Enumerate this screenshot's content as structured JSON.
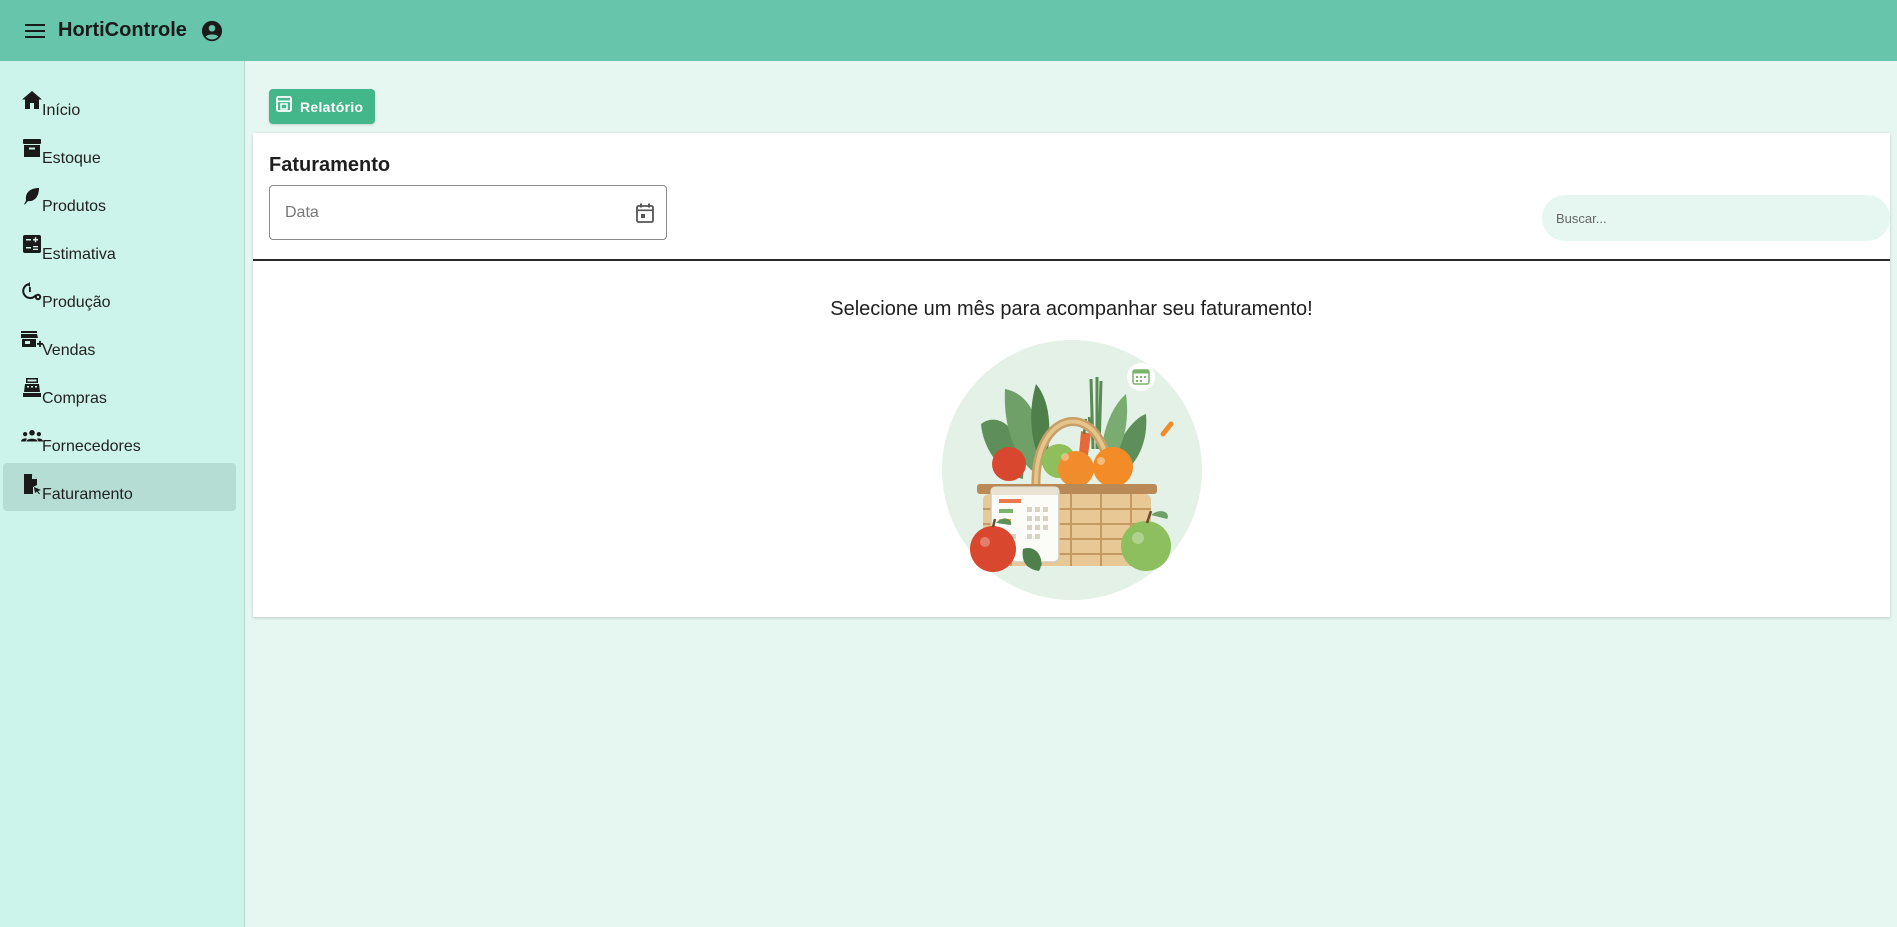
{
  "app": {
    "title": "HortiControle"
  },
  "topbar": {
    "menu_icon": "menu-icon",
    "account_icon": "account-circle-icon"
  },
  "sidebar": {
    "items": [
      {
        "label": "Início",
        "icon": "home-icon",
        "active": false
      },
      {
        "label": "Estoque",
        "icon": "archive-icon",
        "active": false
      },
      {
        "label": "Produtos",
        "icon": "leaf-icon",
        "active": false
      },
      {
        "label": "Estimativa",
        "icon": "calculator-icon",
        "active": false
      },
      {
        "label": "Produção",
        "icon": "history-settings-icon",
        "active": false
      },
      {
        "label": "Vendas",
        "icon": "store-plus-icon",
        "active": false
      },
      {
        "label": "Compras",
        "icon": "cash-register-icon",
        "active": false
      },
      {
        "label": "Fornecedores",
        "icon": "groups-icon",
        "active": false
      },
      {
        "label": "Faturamento",
        "icon": "invoice-icon",
        "active": true
      }
    ]
  },
  "toolbar": {
    "report_label": "Relatório",
    "report_icon": "report-icon"
  },
  "card": {
    "title": "Faturamento",
    "date_placeholder": "Data",
    "date_value": "",
    "calendar_icon": "calendar-icon",
    "search_placeholder": "Buscar...",
    "empty_message": "Selecione um mês para acompanhar seu faturamento!",
    "illustration": "vegetable-basket-calendar-illustration"
  },
  "colors": {
    "topbar": "#66c5aa",
    "sidebar": "#ccf4ea",
    "sidebar_active": "#b5ddd4",
    "content_bg": "#e6f6f1",
    "accent_button": "#43b789"
  }
}
